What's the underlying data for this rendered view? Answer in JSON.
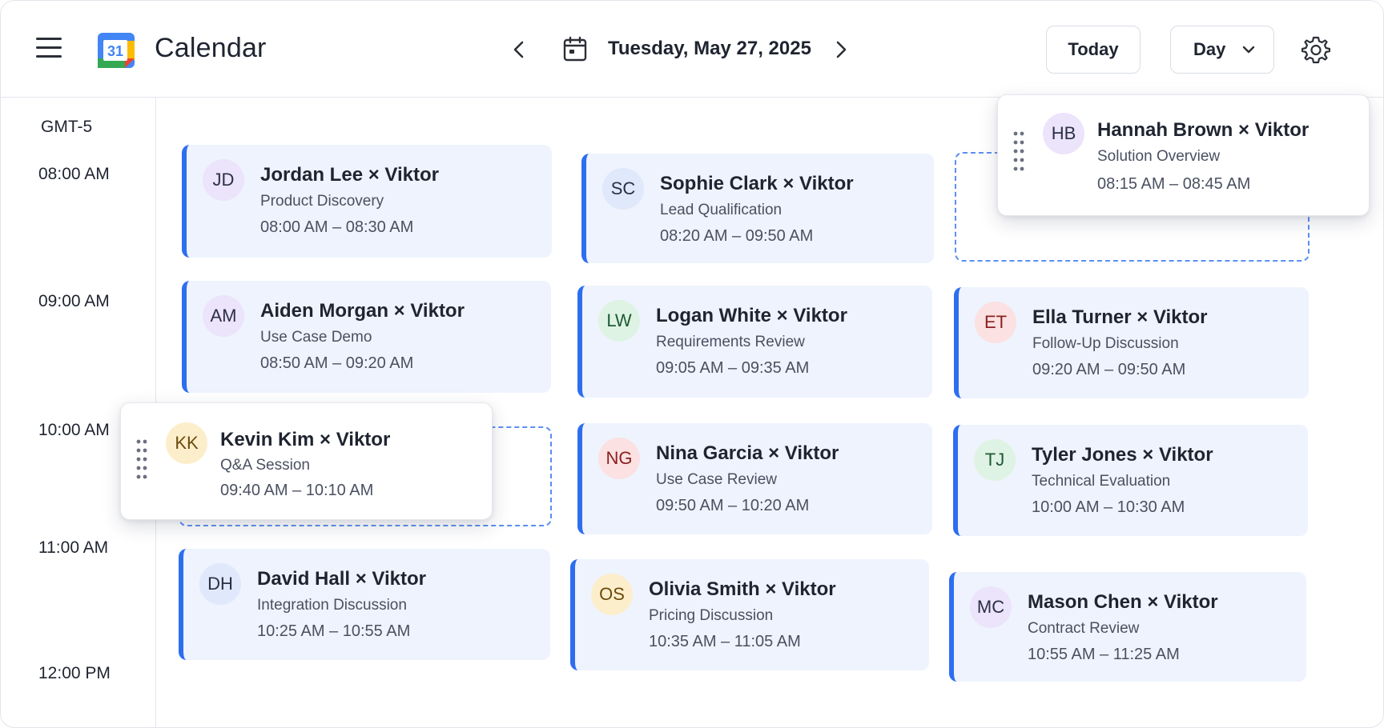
{
  "header": {
    "app_title": "Calendar",
    "logo_number": "31",
    "date_label": "Tuesday, May 27, 2025",
    "today_label": "Today",
    "view_label": "Day"
  },
  "timezone": "GMT-5",
  "time_labels": [
    "08:00 AM",
    "09:00 AM",
    "10:00 AM",
    "11:00 AM",
    "12:00 PM"
  ],
  "colors": {
    "accent": "#2d6ef0",
    "card_bg": "#eef3fd"
  },
  "events": [
    {
      "initials": "JD",
      "title": "Jordan Lee × Viktor",
      "subtitle": "Product Discovery",
      "time": "08:00 AM – 08:30 AM",
      "avatar_bg": "#ece4fb",
      "avatar_fg": "#2b2f45"
    },
    {
      "initials": "SC",
      "title": "Sophie Clark × Viktor",
      "subtitle": "Lead Qualification",
      "time": "08:20 AM – 09:50 AM",
      "avatar_bg": "#dfe9fb",
      "avatar_fg": "#2b2f45"
    },
    {
      "initials": "AM",
      "title": "Aiden Morgan × Viktor",
      "subtitle": "Use Case Demo",
      "time": "08:50 AM – 09:20 AM",
      "avatar_bg": "#ece4fb",
      "avatar_fg": "#2b2f45"
    },
    {
      "initials": "LW",
      "title": "Logan White × Viktor",
      "subtitle": "Requirements Review",
      "time": "09:05 AM – 09:35 AM",
      "avatar_bg": "#def3e4",
      "avatar_fg": "#1e5a33"
    },
    {
      "initials": "ET",
      "title": "Ella Turner × Viktor",
      "subtitle": "Follow-Up Discussion",
      "time": "09:20 AM – 09:50 AM",
      "avatar_bg": "#fbe1e1",
      "avatar_fg": "#8a1f1f"
    },
    {
      "initials": "NG",
      "title": "Nina Garcia × Viktor",
      "subtitle": "Use Case Review",
      "time": "09:50 AM – 10:20 AM",
      "avatar_bg": "#fbe1e1",
      "avatar_fg": "#8a1f1f"
    },
    {
      "initials": "TJ",
      "title": "Tyler Jones × Viktor",
      "subtitle": "Technical Evaluation",
      "time": "10:00 AM – 10:30 AM",
      "avatar_bg": "#def3e4",
      "avatar_fg": "#1e5a33"
    },
    {
      "initials": "DH",
      "title": "David Hall × Viktor",
      "subtitle": "Integration Discussion",
      "time": "10:25 AM – 10:55 AM",
      "avatar_bg": "#dfe9fb",
      "avatar_fg": "#2b2f45"
    },
    {
      "initials": "OS",
      "title": "Olivia Smith × Viktor",
      "subtitle": "Pricing Discussion",
      "time": "10:35 AM – 11:05 AM",
      "avatar_bg": "#fdeecb",
      "avatar_fg": "#6b4a0c"
    },
    {
      "initials": "MC",
      "title": "Mason Chen × Viktor",
      "subtitle": "Contract Review",
      "time": "10:55 AM – 11:25 AM",
      "avatar_bg": "#ece4fb",
      "avatar_fg": "#2b2f45"
    }
  ],
  "dragging": [
    {
      "initials": "HB",
      "title": "Hannah Brown × Viktor",
      "subtitle": "Solution Overview",
      "time": "08:15 AM – 08:45 AM",
      "avatar_bg": "#ece4fb",
      "avatar_fg": "#2b2f45"
    },
    {
      "initials": "KK",
      "title": "Kevin Kim × Viktor",
      "subtitle": "Q&A Session",
      "time": "09:40 AM – 10:10 AM",
      "avatar_bg": "#fdeecb",
      "avatar_fg": "#6b4a0c"
    }
  ]
}
